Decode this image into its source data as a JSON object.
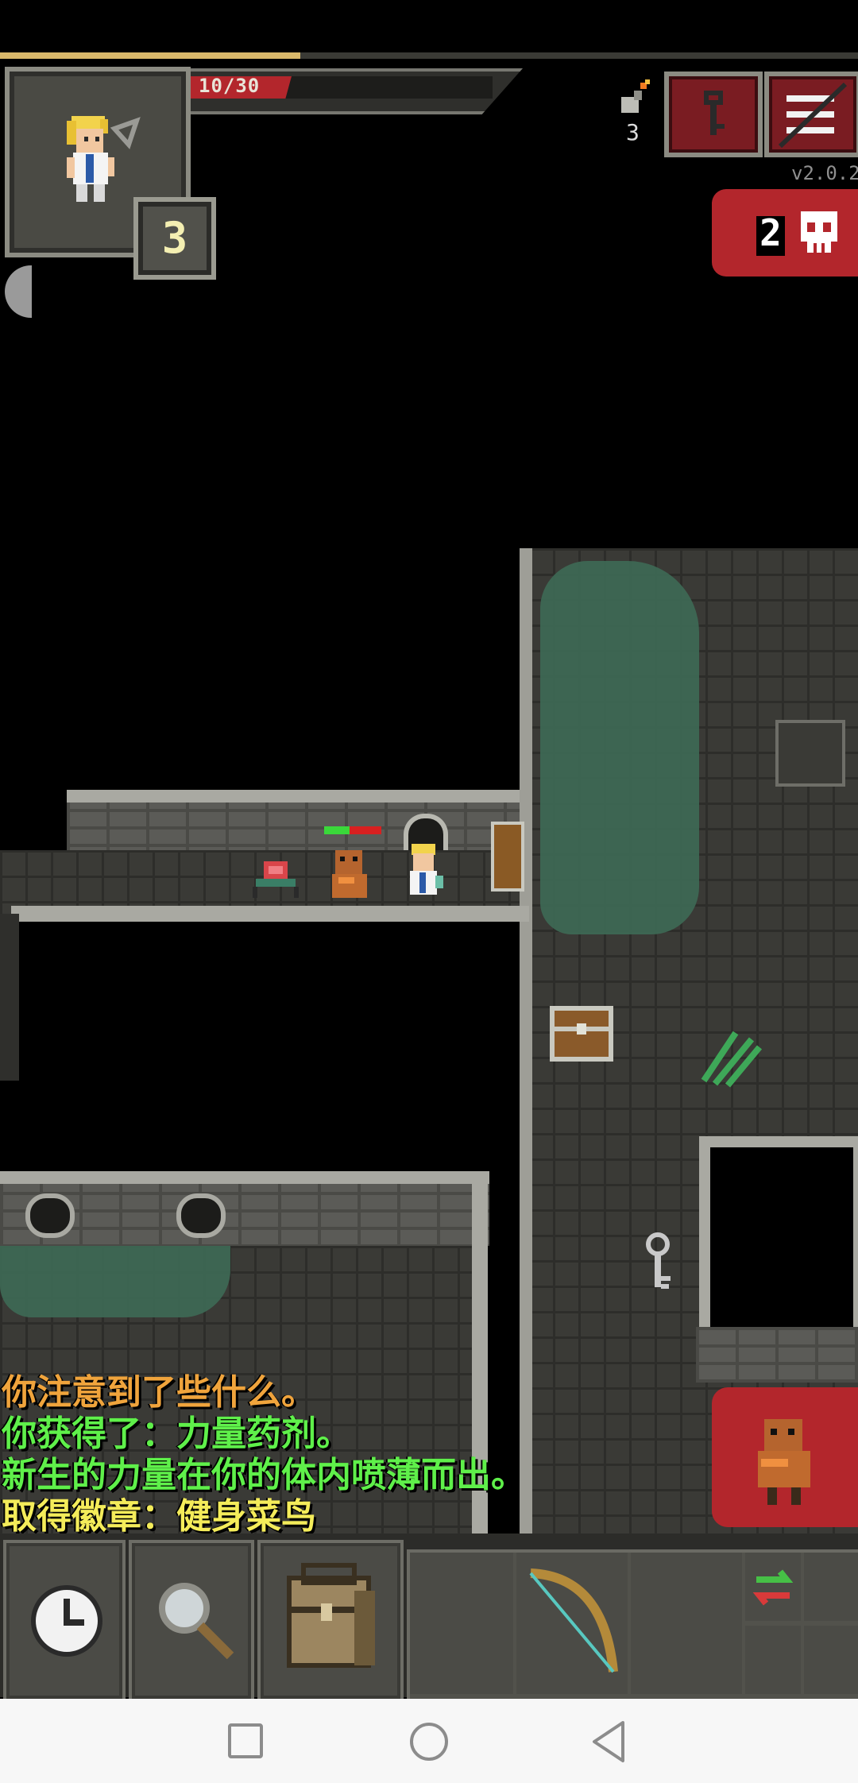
{
  "hud": {
    "hp_text": "10/30",
    "hp_fraction": 0.333,
    "xp_fraction": 0.35,
    "depth": "3",
    "tnt_count": "3",
    "version": "v2.0.2",
    "danger_count": "2"
  },
  "log": [
    {
      "text": "你注意到了些什么。",
      "color": "#f0a43c"
    },
    {
      "text": "你获得了：力量药剂。",
      "color": "#5ff04a"
    },
    {
      "text": "新生的力量在你的体内喷薄而出。",
      "color": "#5ff04a"
    },
    {
      "text": "取得徽章：健身菜鸟",
      "color": "#f4ec5a"
    }
  ],
  "colors": {
    "hp": "#b3262c",
    "xp": "#d9b86a",
    "button_red": "#7a1c22",
    "danger_red": "#b3262c"
  },
  "toolbar": {
    "wait_icon": "clock-icon",
    "search_icon": "magnifier-icon",
    "backpack_icon": "backpack-icon",
    "quickslot_item": "bow-icon",
    "swap_icon": "swap-arrows-icon"
  },
  "navbar": {
    "icons": [
      "square-icon",
      "circle-icon",
      "back-triangle-icon"
    ]
  }
}
